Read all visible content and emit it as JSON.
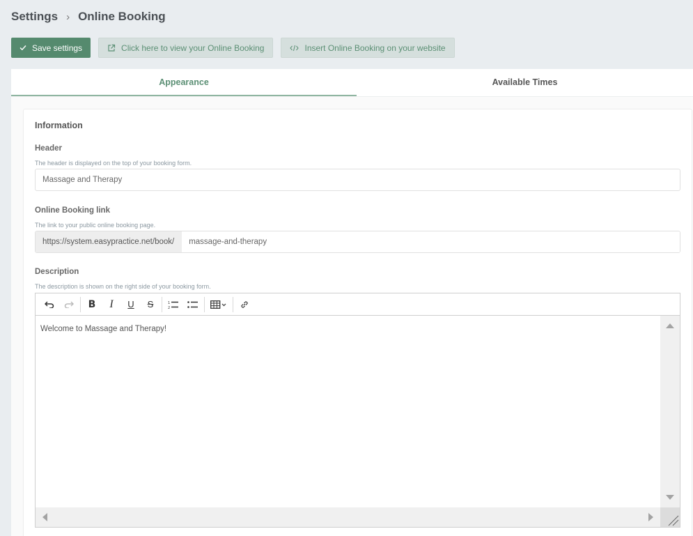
{
  "breadcrumb": {
    "parent": "Settings",
    "separator": "›",
    "current": "Online Booking"
  },
  "toolbar": {
    "save_label": "Save settings",
    "save_icon": "check-icon",
    "view_label": "Click here to view your Online Booking",
    "view_icon": "external-link-icon",
    "insert_label": "Insert Online Booking on your website",
    "insert_icon": "code-icon"
  },
  "tabs": [
    {
      "label": "Appearance",
      "active": true
    },
    {
      "label": "Available Times",
      "active": false
    }
  ],
  "card": {
    "title": "Information",
    "header_field": {
      "label": "Header",
      "help": "The header is displayed on the top of your booking form.",
      "value": "Massage and Therapy"
    },
    "link_field": {
      "label": "Online Booking link",
      "help": "The link to your public online booking page.",
      "prefix": "https://system.easypractice.net/book/",
      "value": "massage-and-therapy"
    },
    "description_field": {
      "label": "Description",
      "help": "The description is shown on the right side of your booking form.",
      "content": "Welcome to Massage and Therapy!"
    }
  },
  "editor_toolbar": [
    "undo-icon",
    "redo-icon",
    "bold-icon",
    "italic-icon",
    "underline-icon",
    "strikethrough-icon",
    "ordered-list-icon",
    "bullet-list-icon",
    "table-icon",
    "link-icon"
  ],
  "colors": {
    "primary": "#558a6e",
    "accent_text": "#5b8f74",
    "secondary_bg": "#d5dfdd",
    "page_bg": "#e9edf0",
    "grammarly": "#15c39a"
  }
}
